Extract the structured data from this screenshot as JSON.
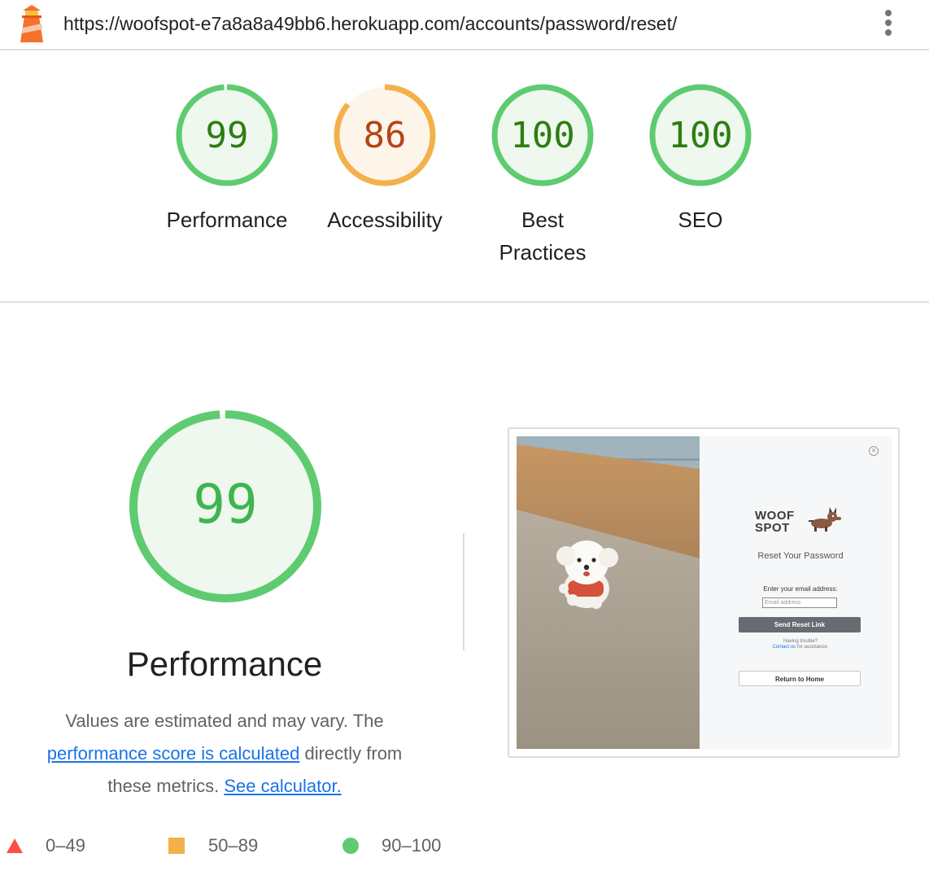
{
  "topbar": {
    "url": "https://woofspot-e7a8a8a49bb6.herokuapp.com/accounts/password/reset/",
    "lighthouse_icon": "lighthouse-icon",
    "menu_icon": "more-vert-icon"
  },
  "gauges": [
    {
      "key": "performance",
      "score": "99",
      "label": "Performance",
      "fraction": 0.99,
      "status": "pass"
    },
    {
      "key": "accessibility",
      "score": "86",
      "label": "Accessibility",
      "fraction": 0.86,
      "status": "average"
    },
    {
      "key": "best-practices",
      "score": "100",
      "label_line1": "Best",
      "label_line2": "Practices",
      "fraction": 1.0,
      "status": "pass"
    },
    {
      "key": "seo",
      "score": "100",
      "label": "SEO",
      "fraction": 1.0,
      "status": "pass"
    }
  ],
  "detail": {
    "score": "99",
    "fraction": 0.99,
    "title": "Performance",
    "desc_part1": "Values are estimated and may vary. The",
    "desc_link1": "performance score is calculated",
    "desc_part2": "directly from",
    "desc_part3": "these metrics.",
    "desc_link2": "See calculator."
  },
  "legend": {
    "fail": "0–49",
    "average": "50–89",
    "pass": "90–100"
  },
  "screenshot": {
    "brand_line1": "WOOF",
    "brand_line2": "SPOT",
    "title": "Reset Your Password",
    "email_label": "Enter your email address:",
    "email_placeholder": "Email address",
    "send_button": "Send Reset Link",
    "trouble_text": "Having trouble?",
    "contact_link": "Contact us",
    "contact_suffix": "for assistance.",
    "home_button": "Return to Home",
    "close_icon": "close-circle-icon"
  },
  "colors": {
    "pass": "#0cce6b",
    "pass_stroke": "#5fcb70",
    "pass_text": "#2e7d12",
    "pass_fill": "#eef8ef",
    "average": "#f4b04a",
    "average_text": "#b44515",
    "average_fill": "#fdf5ea",
    "fail": "#ff4e42",
    "link": "#1a73e8"
  }
}
